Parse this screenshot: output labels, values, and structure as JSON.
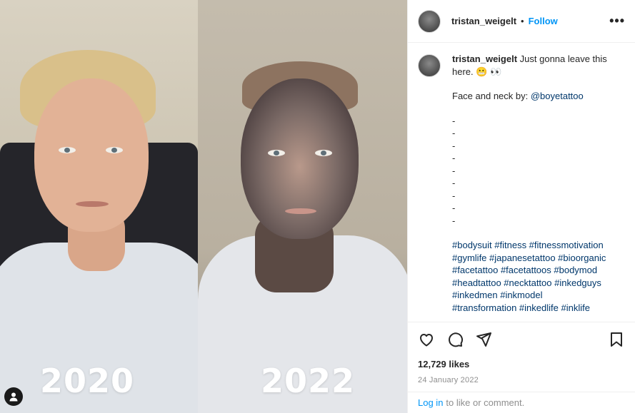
{
  "media": {
    "left_label": "2020",
    "right_label": "2022"
  },
  "header": {
    "username": "tristan_weigelt",
    "separator": "•",
    "follow_label": "Follow",
    "more_label": "•••"
  },
  "caption": {
    "username": "tristan_weigelt",
    "text": "Just gonna leave this here. 😬 👀",
    "credit_prefix": "Face and neck by: ",
    "credit_mention": "@boyetattoo",
    "dashes": [
      "-",
      "-",
      "-",
      "-",
      "-",
      "-",
      "-",
      "-",
      "-"
    ],
    "hashtag_lines": [
      "#bodysuit #fitness #fitnessmotivation",
      "#gymlife #japanesetattoo #bioorganic",
      "#facetattoo #facetattoos #bodymod",
      "#headtattoo #necktattoo #inkedguys",
      "#inkedmen #inkmodel",
      "#transformation #inkedlife #inklife"
    ]
  },
  "actions": {
    "icons": [
      "heart-icon",
      "comment-icon",
      "share-icon",
      "bookmark-icon"
    ]
  },
  "likes": "12,729 likes",
  "date": "24 January 2022",
  "footer": {
    "login_label": "Log in",
    "rest": "to like or comment."
  },
  "colors": {
    "link_blue": "#0095f6",
    "hashtag": "#00376b",
    "muted": "#8e8e8e"
  }
}
